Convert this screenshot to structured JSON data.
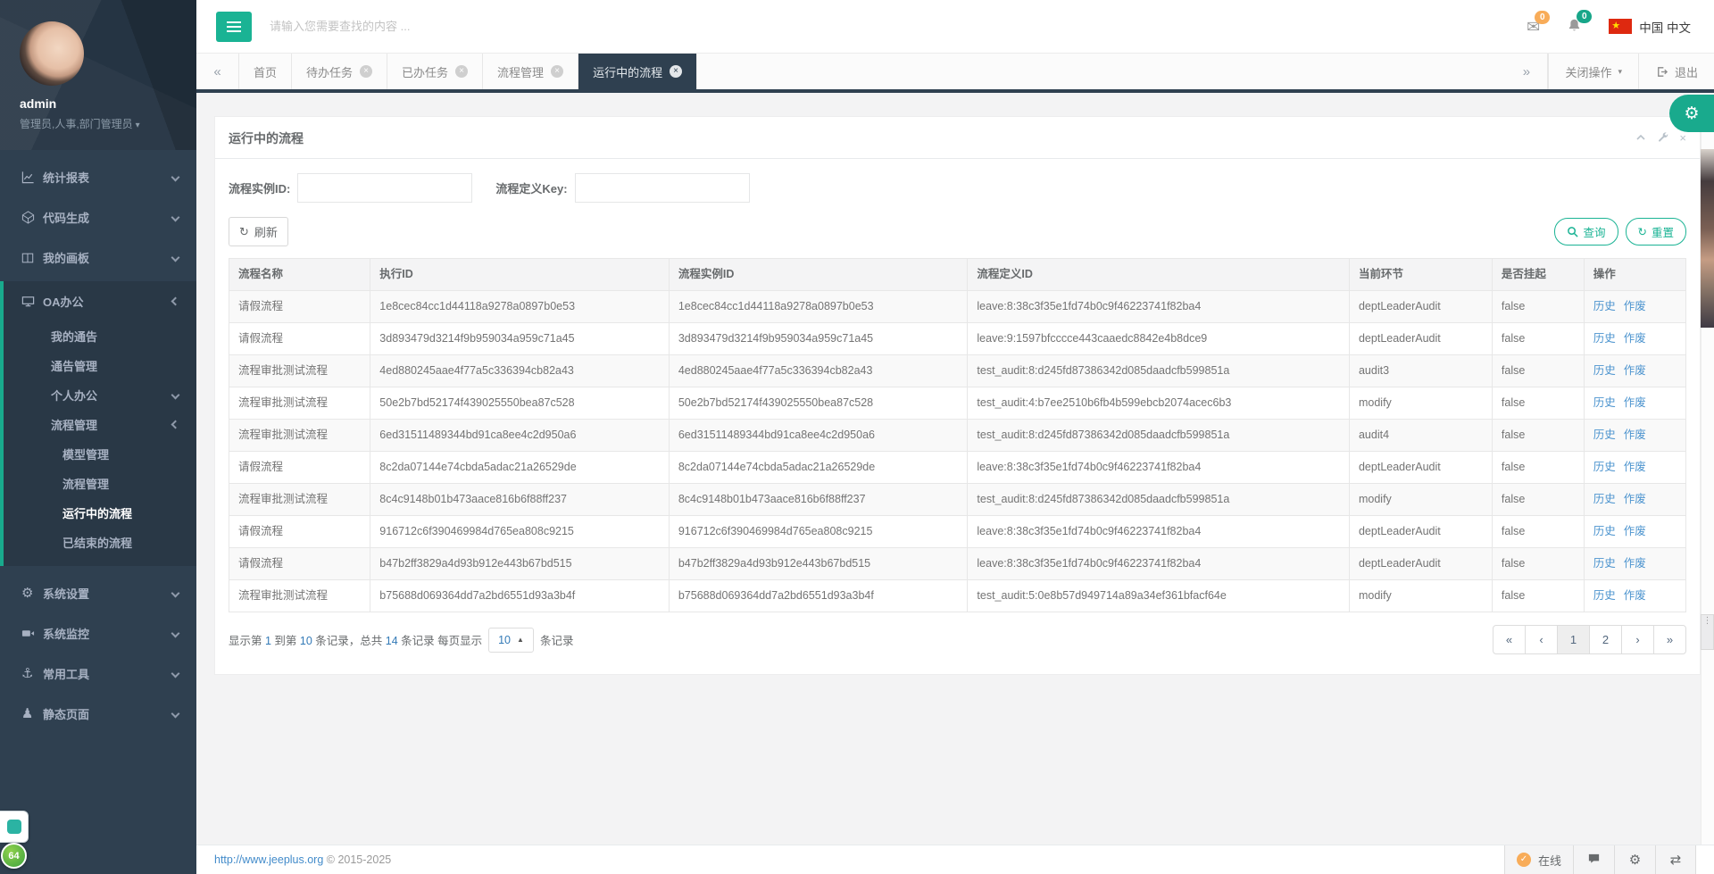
{
  "topbar": {
    "search_placeholder": "请输入您需要查找的内容 ...",
    "mail_badge": "0",
    "bell_badge": "0",
    "locale": "中国 中文"
  },
  "tabs": {
    "close_ops_label": "关闭操作",
    "exit_label": "退出",
    "items": [
      {
        "name": "home",
        "label": "首页",
        "closable": false,
        "active": false
      },
      {
        "name": "todo-tasks",
        "label": "待办任务",
        "closable": true,
        "active": false
      },
      {
        "name": "done-tasks",
        "label": "已办任务",
        "closable": true,
        "active": false
      },
      {
        "name": "process-mgmt",
        "label": "流程管理",
        "closable": true,
        "active": false
      },
      {
        "name": "running-processes",
        "label": "运行中的流程",
        "closable": true,
        "active": true
      }
    ]
  },
  "sidebar": {
    "username": "admin",
    "roles": "管理员,人事,部门管理员",
    "items": [
      {
        "name": "stats-report",
        "icon": "line-chart-icon",
        "label": "统计报表",
        "chevron": "collapsed"
      },
      {
        "name": "code-gen",
        "icon": "code-icon",
        "label": "代码生成",
        "chevron": "collapsed"
      },
      {
        "name": "my-dashboard",
        "icon": "columns-icon",
        "label": "我的画板",
        "chevron": "collapsed"
      },
      {
        "name": "oa-office",
        "icon": "desktop-icon",
        "label": "OA办公",
        "chevron": "expanded",
        "active": true,
        "children": [
          {
            "name": "my-notices",
            "label": "我的通告"
          },
          {
            "name": "notice-mgmt",
            "label": "通告管理"
          },
          {
            "name": "personal-office",
            "label": "个人办公",
            "chevron": "collapsed"
          },
          {
            "name": "process-mgmt",
            "label": "流程管理",
            "chevron": "expanded",
            "children": [
              {
                "name": "model-mgmt",
                "label": "模型管理"
              },
              {
                "name": "process-mgmt-list",
                "label": "流程管理"
              },
              {
                "name": "running-processes",
                "label": "运行中的流程",
                "active": true
              },
              {
                "name": "finished-processes",
                "label": "已结束的流程"
              }
            ]
          }
        ]
      },
      {
        "name": "system-settings",
        "icon": "gear-icon",
        "label": "系统设置",
        "chevron": "collapsed"
      },
      {
        "name": "system-monitor",
        "icon": "video-icon",
        "label": "系统监控",
        "chevron": "collapsed"
      },
      {
        "name": "common-tools",
        "icon": "anchor-icon",
        "label": "常用工具",
        "chevron": "collapsed"
      },
      {
        "name": "static-pages",
        "icon": "street-view-icon",
        "label": "静态页面",
        "chevron": "collapsed"
      }
    ]
  },
  "panel": {
    "title": "运行中的流程",
    "form": {
      "instance_label": "流程实例ID:",
      "key_label": "流程定义Key:"
    },
    "refresh_label": "刷新",
    "query_label": "查询",
    "reset_label": "重置"
  },
  "table": {
    "columns": [
      "流程名称",
      "执行ID",
      "流程实例ID",
      "流程定义ID",
      "当前环节",
      "是否挂起",
      "操作"
    ],
    "op_labels": [
      "历史",
      "作废"
    ],
    "rows": [
      [
        "请假流程",
        "1e8cec84cc1d44118a9278a0897b0e53",
        "1e8cec84cc1d44118a9278a0897b0e53",
        "leave:8:38c3f35e1fd74b0c9f46223741f82ba4",
        "deptLeaderAudit",
        "false"
      ],
      [
        "请假流程",
        "3d893479d3214f9b959034a959c71a45",
        "3d893479d3214f9b959034a959c71a45",
        "leave:9:1597bfcccce443caaedc8842e4b8dce9",
        "deptLeaderAudit",
        "false"
      ],
      [
        "流程审批测试流程",
        "4ed880245aae4f77a5c336394cb82a43",
        "4ed880245aae4f77a5c336394cb82a43",
        "test_audit:8:d245fd87386342d085daadcfb599851a",
        "audit3",
        "false"
      ],
      [
        "流程审批测试流程",
        "50e2b7bd52174f439025550bea87c528",
        "50e2b7bd52174f439025550bea87c528",
        "test_audit:4:b7ee2510b6fb4b599ebcb2074acec6b3",
        "modify",
        "false"
      ],
      [
        "流程审批测试流程",
        "6ed31511489344bd91ca8ee4c2d950a6",
        "6ed31511489344bd91ca8ee4c2d950a6",
        "test_audit:8:d245fd87386342d085daadcfb599851a",
        "audit4",
        "false"
      ],
      [
        "请假流程",
        "8c2da07144e74cbda5adac21a26529de",
        "8c2da07144e74cbda5adac21a26529de",
        "leave:8:38c3f35e1fd74b0c9f46223741f82ba4",
        "deptLeaderAudit",
        "false"
      ],
      [
        "流程审批测试流程",
        "8c4c9148b01b473aace816b6f88ff237",
        "8c4c9148b01b473aace816b6f88ff237",
        "test_audit:8:d245fd87386342d085daadcfb599851a",
        "modify",
        "false"
      ],
      [
        "请假流程",
        "916712c6f390469984d765ea808c9215",
        "916712c6f390469984d765ea808c9215",
        "leave:8:38c3f35e1fd74b0c9f46223741f82ba4",
        "deptLeaderAudit",
        "false"
      ],
      [
        "请假流程",
        "b47b2ff3829a4d93b912e443b67bd515",
        "b47b2ff3829a4d93b912e443b67bd515",
        "leave:8:38c3f35e1fd74b0c9f46223741f82ba4",
        "deptLeaderAudit",
        "false"
      ],
      [
        "流程审批测试流程",
        "b75688d069364dd7a2bd6551d93a3b4f",
        "b75688d069364dd7a2bd6551d93a3b4f",
        "test_audit:5:0e8b57d949714a89a34ef361bfacf64e",
        "modify",
        "false"
      ]
    ]
  },
  "pagination": {
    "summary": [
      {
        "t": "显示第 "
      },
      {
        "n": "1"
      },
      {
        "t": " 到第 "
      },
      {
        "n": "10"
      },
      {
        "t": " 条记录，总共 "
      },
      {
        "n": "14"
      },
      {
        "t": " 条记录 每页显示 "
      }
    ],
    "page_size": "10",
    "suffix": "条记录",
    "pager": [
      {
        "name": "first",
        "label": "«"
      },
      {
        "name": "prev",
        "label": "‹"
      },
      {
        "name": "page-1",
        "label": "1",
        "active": true
      },
      {
        "name": "page-2",
        "label": "2"
      },
      {
        "name": "next",
        "label": "›"
      },
      {
        "name": "last",
        "label": "»"
      }
    ]
  },
  "footer": {
    "link_text": "http://www.jeeplus.org",
    "copyright": " © 2015-2025",
    "buttons": [
      {
        "name": "online-status",
        "icon": "check-circle-icon",
        "label": "在线"
      },
      {
        "name": "chat",
        "icon": "chat-icon"
      },
      {
        "name": "settings",
        "icon": "gear-icon"
      },
      {
        "name": "layout-switch",
        "icon": "swap-icon"
      }
    ]
  },
  "overlay": {
    "badge": "64"
  }
}
